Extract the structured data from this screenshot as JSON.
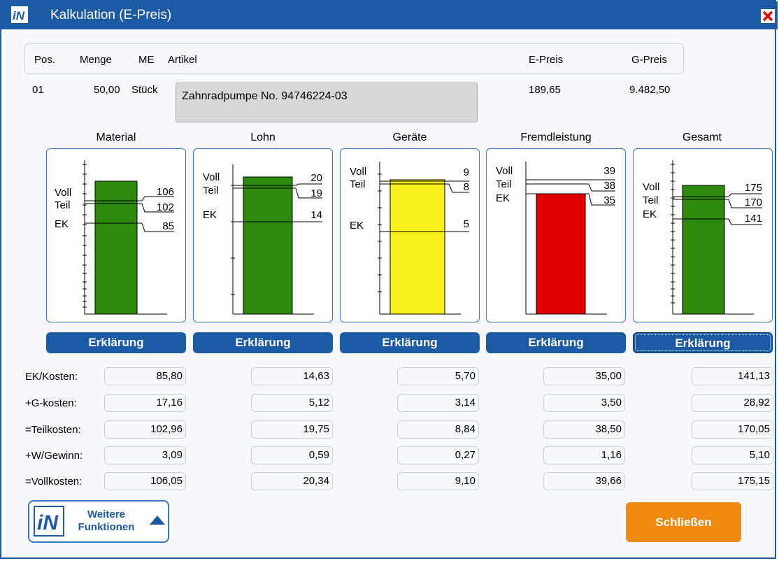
{
  "window": {
    "title": "Kalkulation (E-Preis)"
  },
  "header": {
    "pos_label": "Pos.",
    "menge_label": "Menge",
    "me_label": "ME",
    "artikel_label": "Artikel",
    "epreis_label": "E-Preis",
    "gpreis_label": "G-Preis"
  },
  "position": {
    "pos": "01",
    "menge": "50,00",
    "me": "Stück",
    "artikel": "Zahnradpumpe No. 94746224-03",
    "epreis": "189,65",
    "gpreis": "9.482,50"
  },
  "panels": [
    {
      "title": "Material",
      "bar_color": "#2e8a0c",
      "bar_top_value": "Voll",
      "lines": [
        {
          "label": "Voll",
          "value": "106"
        },
        {
          "label": "Teil",
          "value": "102"
        },
        {
          "label": "EK",
          "value": "85"
        }
      ],
      "button": "Erklärung"
    },
    {
      "title": "Lohn",
      "bar_color": "#2e8a0c",
      "lines": [
        {
          "label": "Voll",
          "value": "20"
        },
        {
          "label": "Teil",
          "value": "19"
        },
        {
          "label": "EK",
          "value": "14"
        }
      ],
      "button": "Erklärung"
    },
    {
      "title": "Geräte",
      "bar_color": "#f7ef1b",
      "lines": [
        {
          "label": "Voll",
          "value": "9"
        },
        {
          "label": "Teil",
          "value": "8"
        },
        {
          "label": "EK",
          "value": "5"
        }
      ],
      "button": "Erklärung"
    },
    {
      "title": "Fremdleistung",
      "bar_color": "#e00000",
      "lines": [
        {
          "label": "Voll",
          "value": "39"
        },
        {
          "label": "Teil",
          "value": "38"
        },
        {
          "label": "EK",
          "value": "35"
        }
      ],
      "button": "Erklärung"
    },
    {
      "title": "Gesamt",
      "bar_color": "#2e8a0c",
      "lines": [
        {
          "label": "Voll",
          "value": "175"
        },
        {
          "label": "Teil",
          "value": "170"
        },
        {
          "label": "EK",
          "value": "141"
        }
      ],
      "button": "Erklärung"
    }
  ],
  "rows": {
    "labels": [
      "EK/Kosten:",
      "+G-kosten:",
      "=Teilkosten:",
      "+W/Gewinn:",
      "=Vollkosten:"
    ],
    "values": [
      [
        "85,80",
        "14,63",
        "5,70",
        "35,00",
        "141,13"
      ],
      [
        "17,16",
        "5,12",
        "3,14",
        "3,50",
        "28,92"
      ],
      [
        "102,96",
        "19,75",
        "8,84",
        "38,50",
        "170,05"
      ],
      [
        "3,09",
        "0,59",
        "0,27",
        "1,16",
        "5,10"
      ],
      [
        "106,05",
        "20,34",
        "9,10",
        "39,66",
        "175,15"
      ]
    ]
  },
  "footer": {
    "more_line1": "Weitere",
    "more_line2": "Funktionen",
    "close_label": "Schließen"
  },
  "colors": {
    "titlebar": "#1c5aa3",
    "button": "#1c5aa3",
    "close_button": "#ef8a0e"
  },
  "icons": {
    "app": "in-logo-icon",
    "close": "close-x-icon",
    "more_arrow": "triangle-up-icon"
  }
}
